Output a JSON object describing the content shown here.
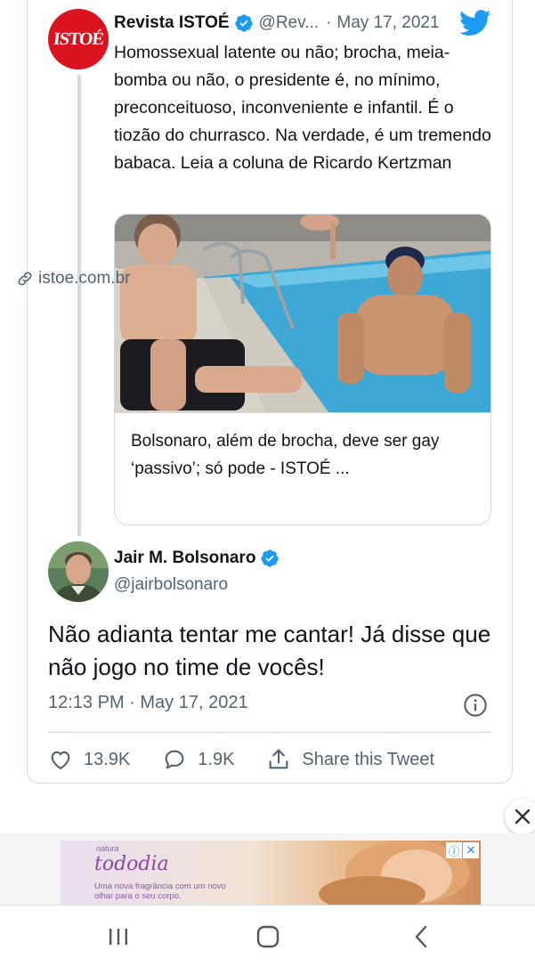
{
  "colors": {
    "twitter_blue": "#1d9bf0",
    "istoe_red": "#d9131f",
    "muted": "#536471",
    "border": "#cfd9de"
  },
  "quoted_tweet": {
    "avatar_text": "ISTOÉ",
    "author_name": "Revista ISTOÉ",
    "handle": "@Rev...",
    "separator": "·",
    "date": "May 17, 2021",
    "text": "Homossexual latente ou não; brocha, meia-bomba ou não, o presidente é, no mínimo, preconceituoso, inconveniente e infantil. É o tiozão do churrasco. Na verdade, é um tremendo babaca. Leia a coluna de Ricardo Kertzman",
    "link_card": {
      "title": "Bolsonaro, além de brocha, deve ser gay ‘passivo’; só pode - ISTOÉ ...",
      "domain": "istoe.com.br",
      "icon": "link-icon"
    }
  },
  "main_tweet": {
    "author_name": "Jair M. Bolsonaro",
    "handle": "@jairbolsonaro",
    "text": "Não adianta tentar me cantar! Já disse que não jogo no time de vocês!",
    "timestamp": "12:13 PM · May 17, 2021",
    "actions": {
      "likes": "13.9K",
      "replies": "1.9K",
      "share_label": "Share this Tweet"
    }
  },
  "ad": {
    "brand_small": "natura",
    "brand": "tododia",
    "tagline": "Uma nova fragrância com um novo olhar para o seu corpo."
  }
}
